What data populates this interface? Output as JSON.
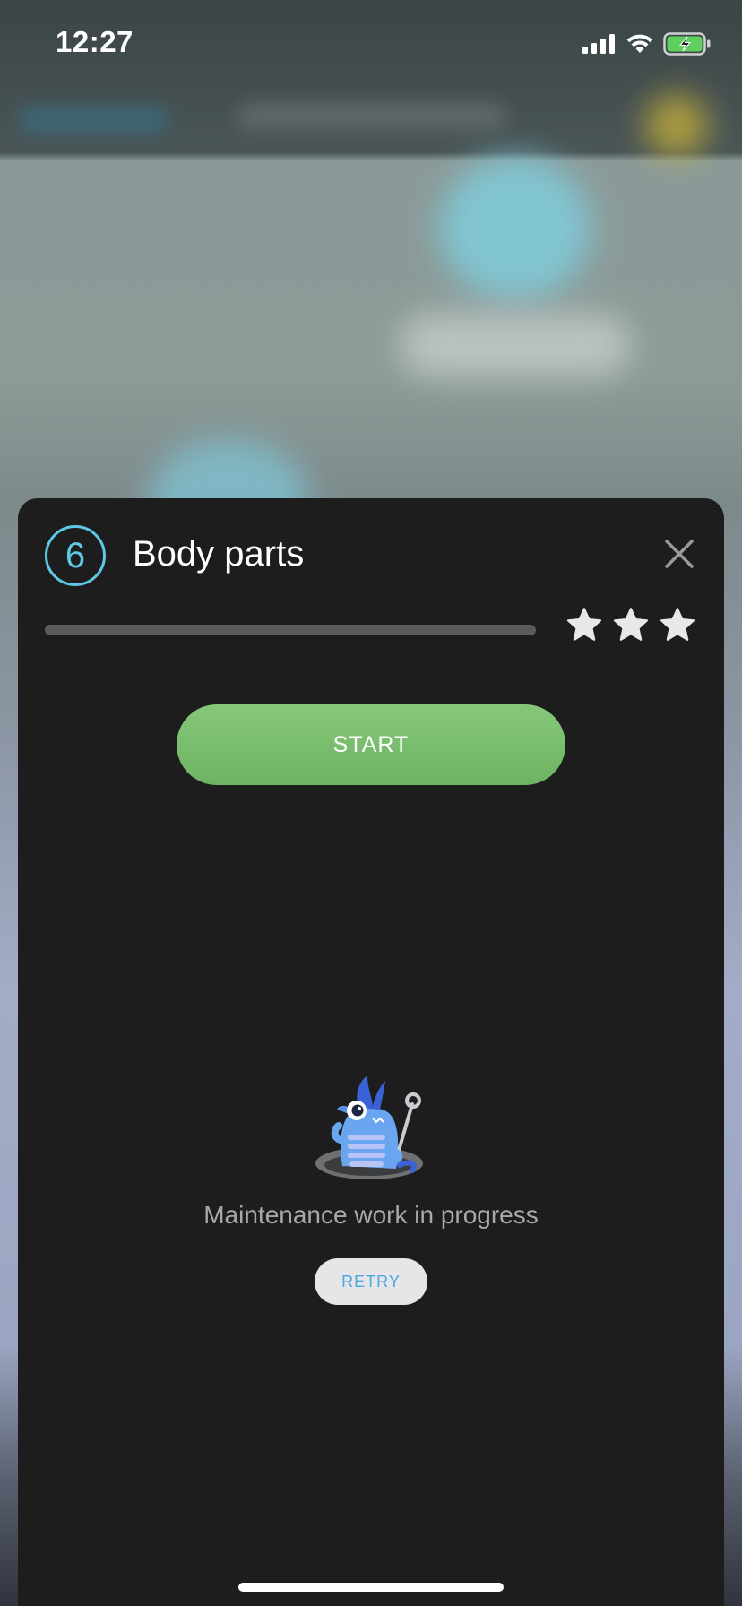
{
  "status_bar": {
    "time": "12:27",
    "icons": [
      "cellular-signal-icon",
      "wifi-icon",
      "battery-charging-icon"
    ]
  },
  "lesson_card": {
    "level_number": "6",
    "title": "Body parts",
    "progress_fraction": 0,
    "stars_earned": 0,
    "stars_total": 3,
    "start_label": "START",
    "maintenance_message": "Maintenance work in progress",
    "retry_label": "RETRY"
  },
  "colors": {
    "accent_cyan": "#5ec9e6",
    "start_green": "#7bc07b",
    "retry_blue": "#4aa9de",
    "sheet_bg": "#1d1d1e"
  }
}
